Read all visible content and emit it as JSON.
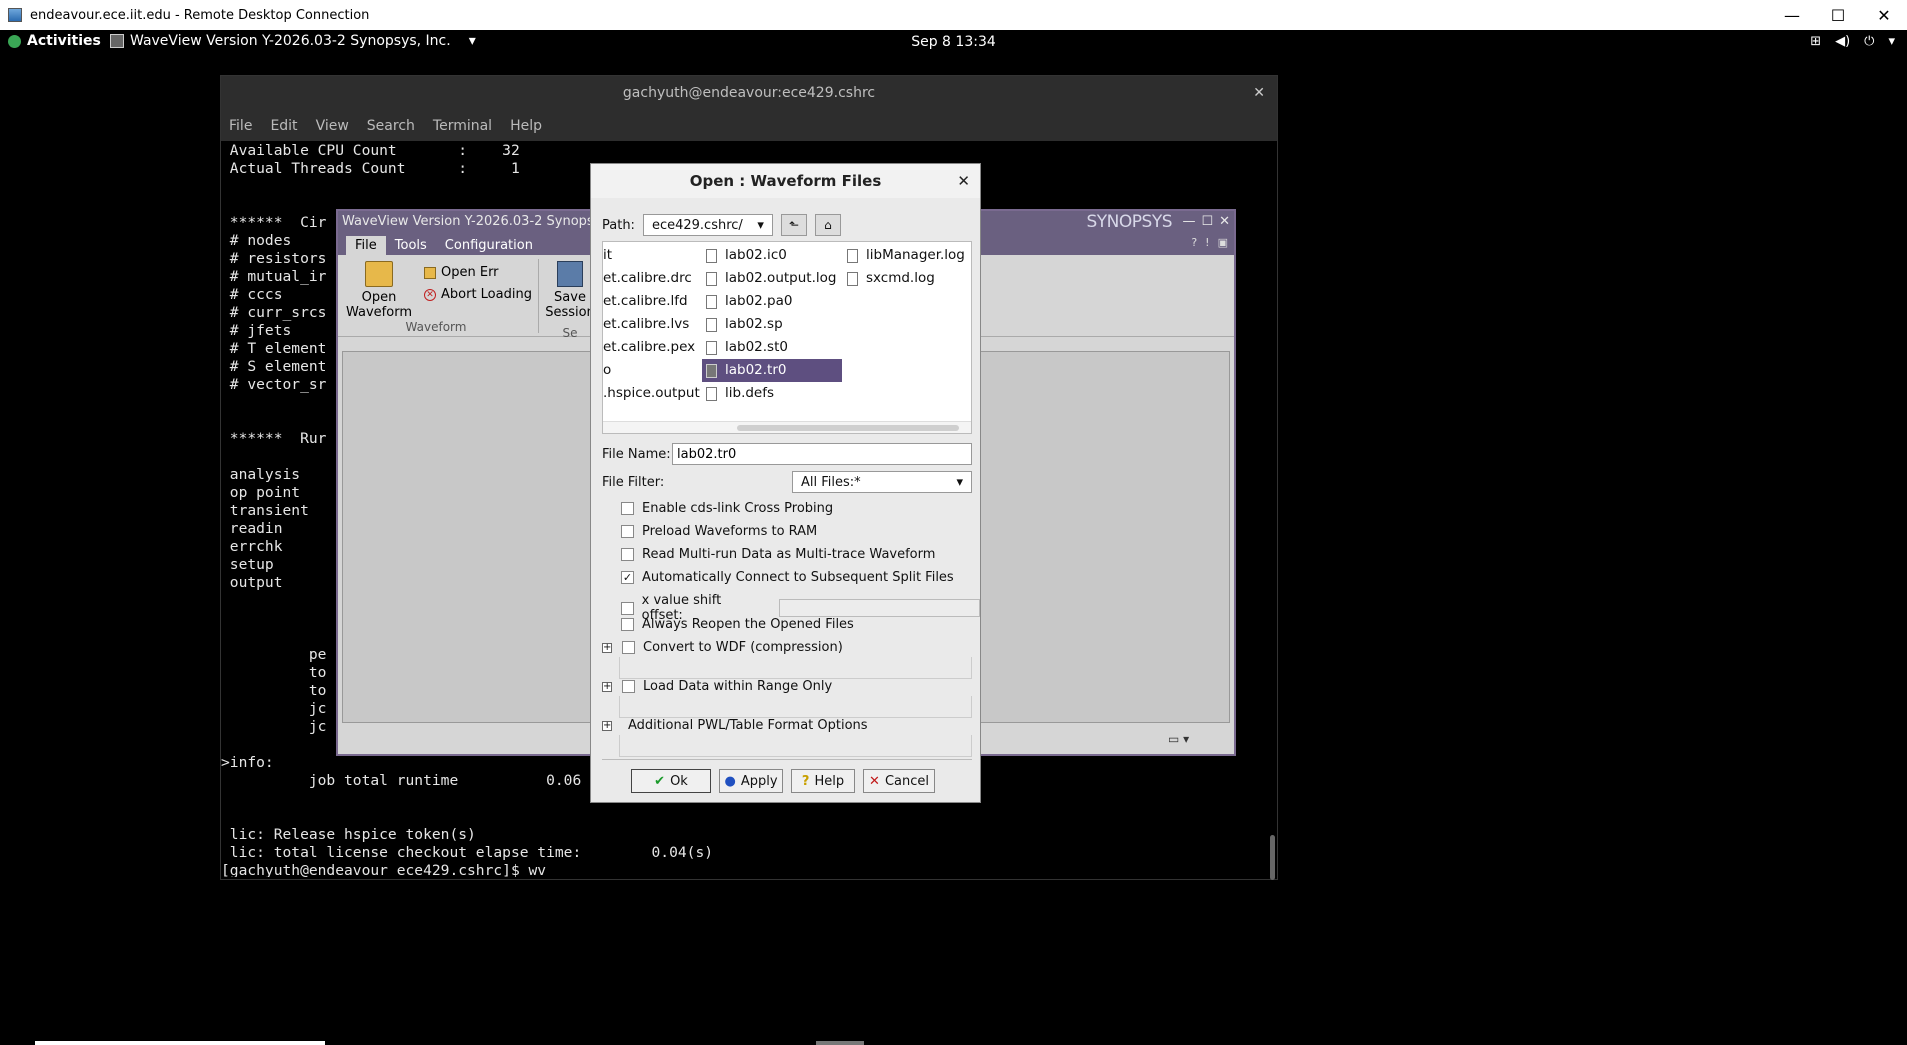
{
  "rdp": {
    "title": "endeavour.ece.iit.edu - Remote Desktop Connection",
    "minimize": "—",
    "maximize": "☐",
    "close": "✕"
  },
  "gnome": {
    "activities": "Activities",
    "app_name": "WaveView Version Y-2026.03-2 Synopsys, Inc.",
    "app_menu_arrow": "▾",
    "clock": "Sep 8  13:34",
    "tray": [
      "⊞",
      "◀)",
      "⏻",
      "▾"
    ]
  },
  "terminal": {
    "title": "gachyuth@endeavour:ece429.cshrc",
    "close": "✕",
    "menu": [
      "File",
      "Edit",
      "View",
      "Search",
      "Terminal",
      "Help"
    ],
    "lines": [
      " Available CPU Count       :    32",
      " Actual Threads Count      :     1",
      "",
      "",
      " ******  Cir",
      " # nodes",
      " # resistors",
      " # mutual_ir",
      " # cccs",
      " # curr_srcs",
      " # jfets",
      " # T element",
      " # S element",
      " # vector_sr",
      "",
      "",
      " ******  Rur",
      "",
      " analysis",
      " op point",
      " transient",
      " readin",
      " errchk",
      " setup",
      " output",
      "",
      "",
      "",
      "          pe",
      "          to",
      "          to",
      "          jc",
      "          jc",
      "",
      ">info:",
      "          job total runtime          0.06",
      "",
      "",
      " lic: Release hspice token(s)",
      " lic: total license checkout elapse time:        0.04(s)",
      "[gachyuth@endeavour ece429.cshrc]$ wv",
      "▯"
    ]
  },
  "waveview": {
    "title": "WaveView Version Y-2026.03-2 Synopsys...",
    "brand": "SYNOPSYS",
    "window_controls": [
      "—",
      "☐",
      "✕"
    ],
    "tabs": [
      "File",
      "Tools",
      "Configuration"
    ],
    "help_icons": [
      "?",
      "!",
      "▣"
    ],
    "open_waveform": "Open Waveform",
    "open_err": "Open Err",
    "abort_loading": "Abort Loading",
    "group_waveform": "Waveform",
    "save_session": "Save Session",
    "group_session": "Se",
    "terminal_icon": "▭ ▾"
  },
  "dialog": {
    "title": "Open : Waveform Files",
    "close": "✕",
    "path_label": "Path:",
    "path_value": "ece429.cshrc/",
    "up_folder_icon": "⬑",
    "home_icon": "⌂",
    "files_col1": [
      "it",
      "et.calibre.drc",
      "et.calibre.lfd",
      "et.calibre.lvs",
      "et.calibre.pex",
      "o",
      ".hspice.output"
    ],
    "files_col2": [
      "lab02.ic0",
      "lab02.output.log",
      "lab02.pa0",
      "lab02.sp",
      "lab02.st0",
      "lab02.tr0",
      "lib.defs"
    ],
    "files_col3": [
      "libManager.log",
      "sxcmd.log"
    ],
    "selected_file": "lab02.tr0",
    "file_name_label": "File Name:",
    "file_name_value": "lab02.tr0",
    "file_filter_label": "File Filter:",
    "file_filter_value": "All Files:*",
    "options": [
      {
        "label": "Enable cds-link Cross Probing",
        "checked": false
      },
      {
        "label": "Preload Waveforms to RAM",
        "checked": false
      },
      {
        "label": "Read Multi-run Data as Multi-trace Waveform",
        "checked": false
      },
      {
        "label": "Automatically Connect to Subsequent Split Files",
        "checked": true
      },
      {
        "label": "x value shift offset:",
        "checked": false
      },
      {
        "label": "Always Reopen the Opened Files",
        "checked": false
      }
    ],
    "expanders": [
      "Convert to WDF (compression)",
      "Load Data within Range Only",
      "Additional PWL/Table Format Options"
    ],
    "buttons": {
      "ok": "Ok",
      "apply": "Apply",
      "help": "Help",
      "cancel": "Cancel"
    },
    "button_icons": {
      "ok": "✔",
      "apply": "●",
      "help": "?",
      "cancel": "✕"
    },
    "colors": {
      "selection": "#5e4f80",
      "ok_icon": "#1a9a2a",
      "apply_icon": "#2050c0",
      "cancel_icon": "#c01818",
      "help_icon": "#c8a000"
    }
  }
}
